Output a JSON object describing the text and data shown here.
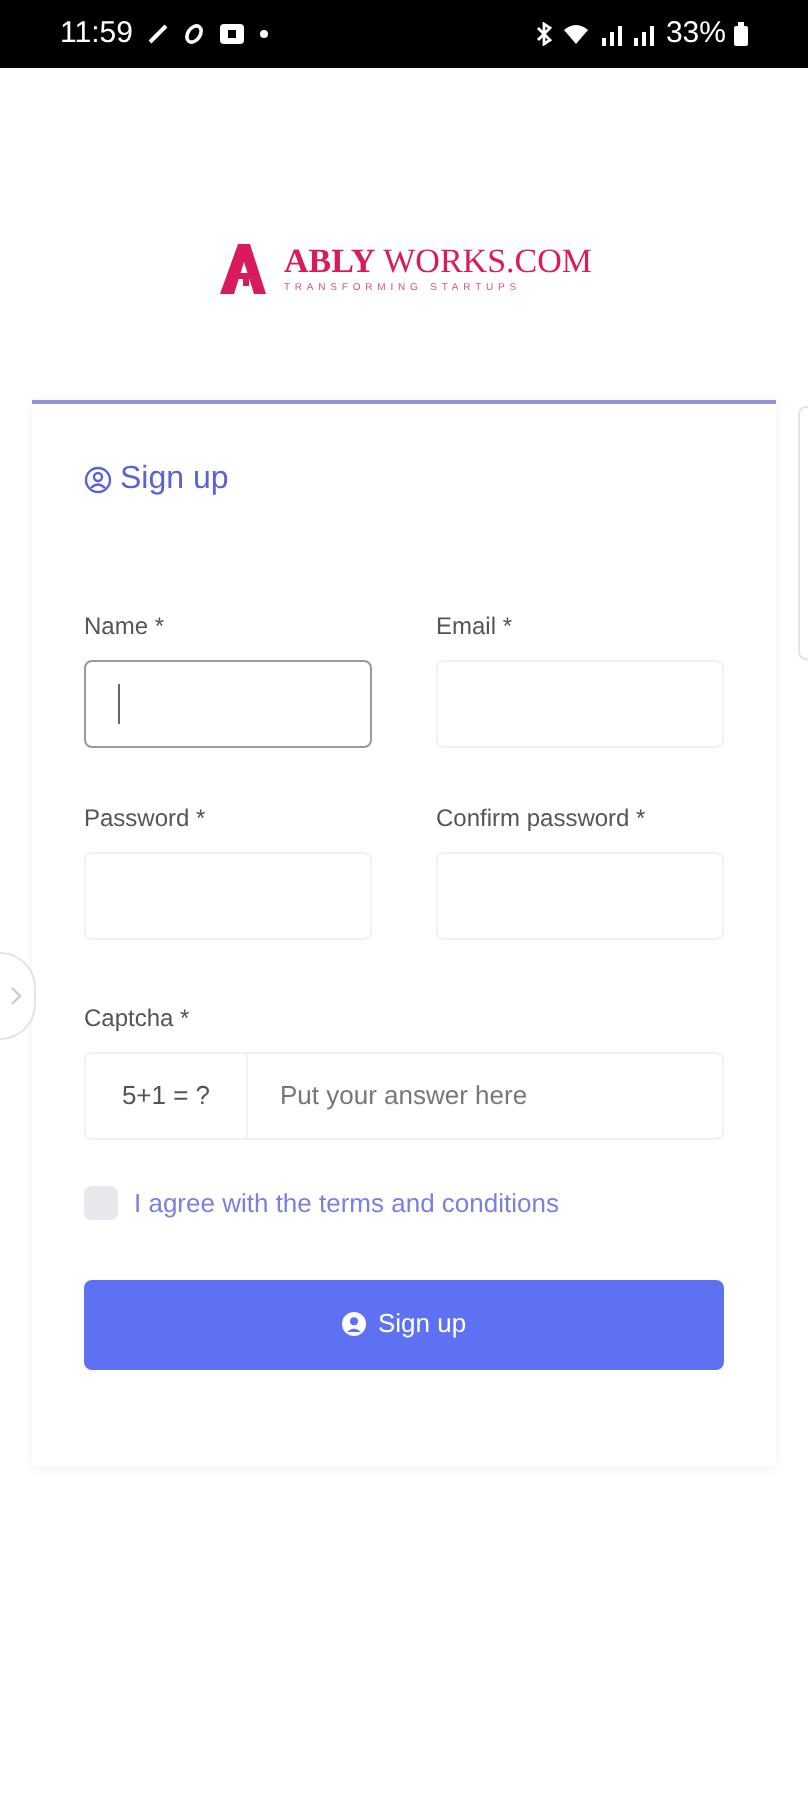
{
  "status_bar": {
    "time": "11:59",
    "battery": "33%"
  },
  "logo": {
    "brand_bold": "ABLY",
    "brand_rest": "WORKS.COM",
    "tagline": "TRANSFORMING STARTUPS"
  },
  "form": {
    "title": "Sign up",
    "fields": [
      {
        "label": "Name *",
        "focused": true
      },
      {
        "label": "Email *",
        "focused": false
      },
      {
        "label": "Password *",
        "focused": false
      },
      {
        "label": "Confirm password *",
        "focused": false
      }
    ],
    "captcha": {
      "label": "Captcha *",
      "question": "5+1 = ?",
      "placeholder": "Put your answer here"
    },
    "terms": {
      "label": "I agree with the terms and conditions",
      "checked": false
    },
    "submit": "Sign up"
  }
}
